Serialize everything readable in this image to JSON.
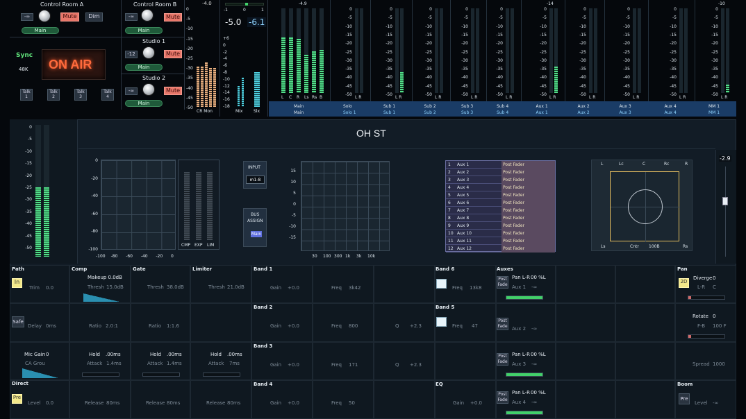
{
  "control_room_a": {
    "title": "Control Room A",
    "minus_inf": "-∞",
    "mute": "Mute",
    "dim": "Dim",
    "main": "Main"
  },
  "control_room_b": {
    "title": "Control Room B",
    "minus_inf": "-∞",
    "mute": "Mute",
    "main": "Main"
  },
  "studio1": {
    "title": "Studio 1",
    "level": "-12",
    "mute": "Mute",
    "main": "Main"
  },
  "studio2": {
    "title": "Studio 2",
    "minus_inf": "-∞",
    "mute": "Mute",
    "main": "Main"
  },
  "sync": {
    "label": "Sync",
    "rate": "48K"
  },
  "on_air": "ON AIR",
  "talk": [
    "Talk\n1",
    "Talk\n2",
    "Talk\n3",
    "Talk\n4"
  ],
  "cr_mon": {
    "peak": "-4.0",
    "label": "CR Mon",
    "scale": [
      "0",
      "-5",
      "-10",
      "-15",
      "-20",
      "-25",
      "-30",
      "-35",
      "-40",
      "-45",
      "-50"
    ]
  },
  "mix_slx": {
    "top_scale": [
      "-1",
      "0",
      "1"
    ],
    "mix_val": "-5.0",
    "slx_val": "-6.1",
    "scale": [
      "+6",
      "0",
      "-2",
      "-4",
      "-6",
      "-8",
      "-10",
      "-12",
      "-14",
      "-16",
      "-18"
    ],
    "mix": "Mix",
    "slx": "Slx"
  },
  "main_meter": {
    "peak": "-4.9",
    "channels": [
      "L",
      "C",
      "R",
      "Ls",
      "Rs",
      "B"
    ],
    "label1": "Main",
    "label2": "Main"
  },
  "bus_meters": [
    {
      "peak": "",
      "label1": "Solo",
      "label2": "Solo 1"
    },
    {
      "peak": "",
      "label1": "Sub 1",
      "label2": "Sub 1"
    },
    {
      "peak": "",
      "label1": "Sub 2",
      "label2": "Sub 2"
    },
    {
      "peak": "",
      "label1": "Sub 3",
      "label2": "Sub 3"
    },
    {
      "peak": "",
      "label1": "Sub 4",
      "label2": "Sub 4"
    },
    {
      "peak": "-14",
      "label1": "Aux 1",
      "label2": "Aux 1"
    },
    {
      "peak": "",
      "label1": "Aux 2",
      "label2": "Aux 2"
    },
    {
      "peak": "",
      "label1": "Aux 3",
      "label2": "Aux 3"
    },
    {
      "peak": "",
      "label1": "Aux 4",
      "label2": "Aux 4"
    },
    {
      "peak": "-10",
      "label1": "MM 1",
      "label2": "MM 1"
    }
  ],
  "bus_scale": [
    "0",
    "-5",
    "-10",
    "-15",
    "-20",
    "-25",
    "-30",
    "-35",
    "-40",
    "-45",
    "-50"
  ],
  "lr": "L R",
  "channel": {
    "name": "OH ST",
    "left_scale": [
      "0",
      "-5",
      "-10",
      "-15",
      "-20",
      "-25",
      "-30",
      "-35",
      "-40",
      "-45",
      "-50"
    ],
    "dyn_y": [
      "0",
      "-20",
      "-40",
      "-60",
      "-80",
      "-100"
    ],
    "dyn_x": [
      "-100",
      "-80",
      "-60",
      "-40",
      "-20",
      "0"
    ],
    "dyn_meters": [
      "CMP",
      "EXP",
      "LIM"
    ],
    "input_label": "INPUT",
    "input_value": "m1-8",
    "bus_assign": "BUS\nASSIGN",
    "bus_assign_main": "Main",
    "eq_y": [
      "15",
      "10",
      "5",
      "0",
      "-5",
      "-10",
      "-15"
    ],
    "eq_x": [
      "30",
      "100",
      "300",
      "1k",
      "3k",
      "10k"
    ],
    "aux_list": [
      {
        "num": "1",
        "name": "Aux 1",
        "mode": "Post Fader"
      },
      {
        "num": "2",
        "name": "Aux 2",
        "mode": "Post Fader"
      },
      {
        "num": "3",
        "name": "Aux 3",
        "mode": "Post Fader"
      },
      {
        "num": "4",
        "name": "Aux 4",
        "mode": "Post Fader"
      },
      {
        "num": "5",
        "name": "Aux 5",
        "mode": "Post Fader"
      },
      {
        "num": "6",
        "name": "Aux 6",
        "mode": "Post Fader"
      },
      {
        "num": "7",
        "name": "Aux 7",
        "mode": "Post Fader"
      },
      {
        "num": "8",
        "name": "Aux 8",
        "mode": "Post Fader"
      },
      {
        "num": "9",
        "name": "Aux 9",
        "mode": "Post Fader"
      },
      {
        "num": "10",
        "name": "Aux 10",
        "mode": "Post Fader"
      },
      {
        "num": "11",
        "name": "Aux 11",
        "mode": "Post Fader"
      },
      {
        "num": "12",
        "name": "Aux 12",
        "mode": "Post Fader"
      }
    ],
    "pan_labels": {
      "L": "L",
      "Lc": "Lc",
      "C": "C",
      "Rc": "Rc",
      "R": "R",
      "Ls": "Ls",
      "Cntr": "Cntr",
      "pct": "100B",
      "Rs": "Rs"
    },
    "fader_value": "-2.9"
  },
  "strip": {
    "path": {
      "header": "Path",
      "in": "In",
      "trim": "Trim",
      "trim_val": "0.0",
      "safe": "Safe",
      "delay": "Delay",
      "delay_val": "0ms",
      "mic_gain": "Mic Gain",
      "mic_gain_val": "0",
      "ca_grou": "CA Grou"
    },
    "direct": {
      "header": "Direct",
      "pre": "Pre",
      "level": "Level",
      "level_val": "0.0"
    },
    "comp": {
      "header": "Comp",
      "makeup": "Makeup 0.0dB",
      "thresh": "Thresh",
      "thresh_val": "15.0dB",
      "ratio": "Ratio",
      "ratio_val": "2.0:1",
      "hold": "Hold",
      "hold_val": ".00ms",
      "attack": "Attack",
      "attack_val": "1.4ms",
      "release": "Release",
      "release_val": "80ms"
    },
    "gate": {
      "header": "Gate",
      "thresh": "Thresh",
      "thresh_val": "38.0dB",
      "ratio": "Ratio",
      "ratio_val": "1:1.6",
      "hold": "Hold",
      "hold_val": ".00ms",
      "attack": "Attack",
      "attack_val": "1.4ms",
      "release": "Release",
      "release_val": "80ms"
    },
    "limiter": {
      "header": "Limiter",
      "thresh": "Thresh",
      "thresh_val": "21.0dB",
      "hold": "Hold",
      "hold_val": ".00ms",
      "attack": "Attack",
      "attack_val": "7ms",
      "release": "Release",
      "release_val": "80ms"
    },
    "bands": [
      {
        "header": "Band 1",
        "gain": "Gain",
        "gain_val": "+0.0",
        "freq": "Freq",
        "freq_val": "3k42",
        "q": "",
        "q_val": ""
      },
      {
        "header": "Band 2",
        "gain": "Gain",
        "gain_val": "+0.0",
        "freq": "Freq",
        "freq_val": "800",
        "q": "Q",
        "q_val": "+2.3"
      },
      {
        "header": "Band 3",
        "gain": "Gain",
        "gain_val": "+0.0",
        "freq": "Freq",
        "freq_val": "171",
        "q": "Q",
        "q_val": "+2.3"
      },
      {
        "header": "Band 4",
        "gain": "Gain",
        "gain_val": "+0.0",
        "freq": "Freq",
        "freq_val": "50",
        "q": "",
        "q_val": ""
      }
    ],
    "band6": {
      "header": "Band 6",
      "freq": "Freq",
      "freq_val": "13k8"
    },
    "band5": {
      "header": "Band 5",
      "freq": "Freq",
      "freq_val": "47"
    },
    "eq": {
      "header": "EQ",
      "gain": "Gain",
      "gain_val": "+0.0"
    },
    "auxes": {
      "header": "Auxes",
      "post": "Post\nFade",
      "pan1": "Pan L-R",
      "pan1_val": "00 %L",
      "aux1": "Aux 1",
      "aux1_val": "-∞",
      "aux2": "Aux 2",
      "aux2_val": "-∞",
      "pan3": "Pan L-R",
      "pan3_val": "00 %L",
      "aux3": "Aux 3",
      "aux3_val": "-∞",
      "pan4": "Pan L-R",
      "pan4_val": "00 %L",
      "aux4": "Aux 4",
      "aux4_val": "-∞"
    },
    "pan": {
      "header": "Pan",
      "btn2d": "2D",
      "diverge": "Diverge",
      "diverge_val": "0",
      "lr": "L-R",
      "lr_val": "C",
      "rotate": "Rotate",
      "rotate_val": "0",
      "fb": "F-B",
      "fb_val": "100 F",
      "spread": "Spread",
      "spread_val": "1000"
    },
    "boom": {
      "header": "Boom",
      "pre": "Pre",
      "level": "Level",
      "level_val": "-∞"
    }
  }
}
